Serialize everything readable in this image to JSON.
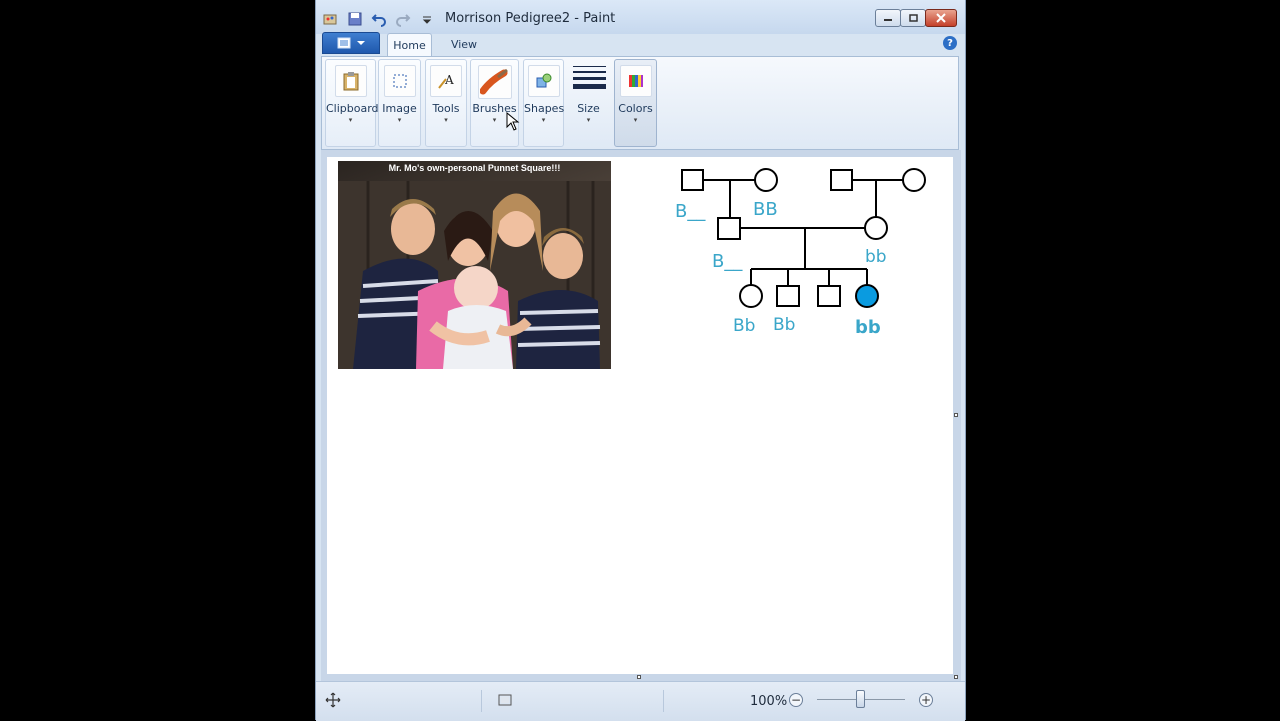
{
  "window": {
    "title": "Morrison Pedigree2 - Paint"
  },
  "tabs": [
    {
      "label": "Home"
    },
    {
      "label": "View"
    }
  ],
  "ribbon": {
    "groups": [
      {
        "label": "Clipboard"
      },
      {
        "label": "Image"
      },
      {
        "label": "Tools"
      },
      {
        "label": "Brushes"
      },
      {
        "label": "Shapes"
      },
      {
        "label": "Size"
      },
      {
        "label": "Colors"
      }
    ]
  },
  "canvas": {
    "photo_caption": "Mr. Mo's own-personal Punnet Square!!!",
    "pedigree_labels": {
      "gp1_male": "B__",
      "gp1_female": "BB",
      "father": "B__",
      "mother": "bb",
      "child1": "Bb",
      "child2": "Bb",
      "child4": "bb"
    },
    "affected_color": "#0a9be0",
    "label_color": "#3aa6c9"
  },
  "status": {
    "zoom": "100%"
  }
}
